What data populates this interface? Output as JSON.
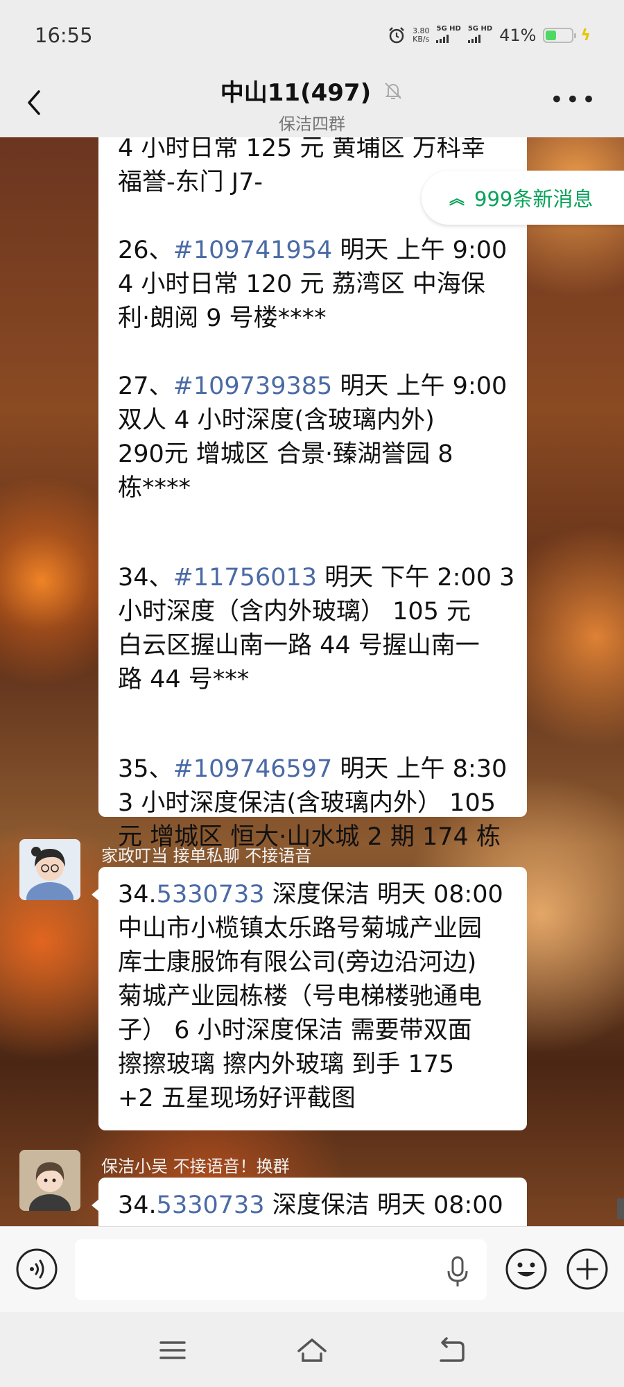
{
  "status_bar": {
    "time": "16:55",
    "net_speed": "3.80",
    "net_speed_unit": "KB/s",
    "sim1": "5G HD",
    "sim2": "5G HD",
    "battery": "41%",
    "battery_level": 0.41
  },
  "header": {
    "title": "中山11(497)",
    "subtitle": "保洁四群"
  },
  "new_messages": "999条新消息",
  "messages": [
    {
      "lines": [
        {
          "text": "4 小时日常 125 元 黄埔区 万科幸"
        },
        {
          "text": "福誉-东门 J7-"
        },
        {
          "gap": true
        },
        {
          "prefix": "26、",
          "link": "#109741954",
          "suffix": " 明天 上午 9:00"
        },
        {
          "text": "4 小时日常 120 元 荔湾区 中海保"
        },
        {
          "text": "利·朗阅 9 号楼****"
        },
        {
          "gap": true
        },
        {
          "prefix": "27、",
          "link": "#109739385",
          "suffix": " 明天 上午 9:00"
        },
        {
          "text": "双人 4 小时深度(含玻璃内外)"
        },
        {
          "text": "290元 增城区 合景·臻湖誉园 8"
        },
        {
          "text": "栋****"
        },
        {
          "gap_lg": true
        },
        {
          "prefix": "34、",
          "link": "#11756013",
          "suffix": " 明天 下午 2:00 3"
        },
        {
          "text": "小时深度（含内外玻璃） 105 元"
        },
        {
          "text": "白云区握山南一路 44 号握山南一"
        },
        {
          "text": "路 44 号***"
        },
        {
          "gap_lg": true
        },
        {
          "prefix": "35、",
          "link": "#109746597",
          "suffix": " 明天 上午 8:30"
        },
        {
          "text": "3 小时深度保洁(含玻璃内外） 105"
        },
        {
          "text": "元 增城区 恒大·山水城 2 期 174 栋"
        }
      ]
    },
    {
      "sender": "家政叮当 接单私聊 不接语音",
      "prefix": "34.",
      "link": "5330733",
      "suffix": " 深度保洁 明天 08:00",
      "lines": [
        "中山市小榄镇太乐路号菊城产业园",
        "库士康服饰有限公司(旁边沿河边)",
        "菊城产业园栋楼（号电梯楼驰通电",
        "子） 6 小时深度保洁 需要带双面",
        "擦擦玻璃   擦内外玻璃  到手 175",
        "+2 五星现场好评截图"
      ]
    },
    {
      "sender": "保洁小吴 不接语音！换群",
      "prefix": "34.",
      "link": "5330733",
      "suffix": " 深度保洁 明天 08:00"
    }
  ],
  "input": {
    "placeholder": ""
  },
  "colors": {
    "link": "#4a6aa5",
    "new_msg": "#07a35a",
    "bubble": "#ffffff"
  }
}
